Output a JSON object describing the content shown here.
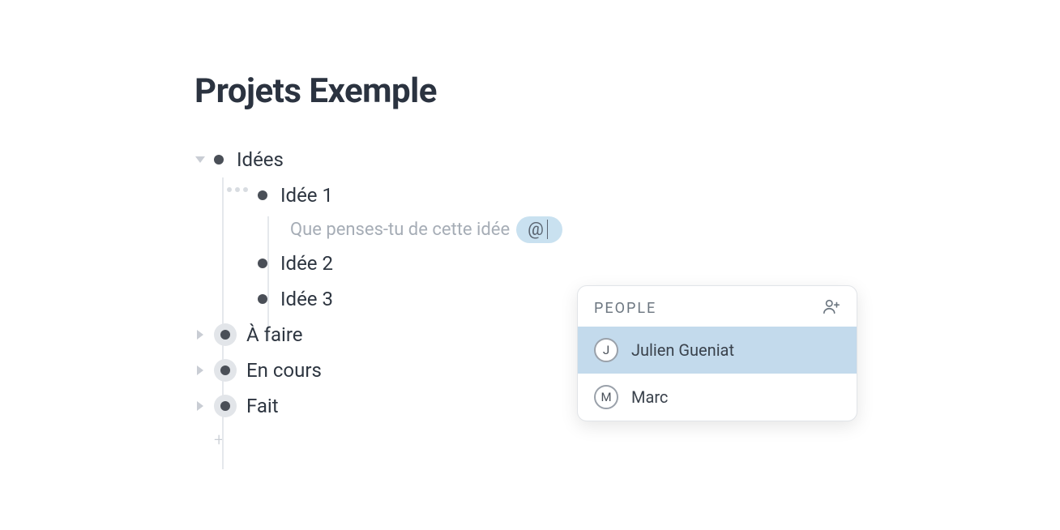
{
  "page": {
    "title": "Projets Exemple"
  },
  "outline": {
    "idees": {
      "label": "Idées",
      "children": {
        "idee1": {
          "label": "Idée 1"
        },
        "idee2": {
          "label": "Idée 2"
        },
        "idee3": {
          "label": "Idée 3"
        }
      }
    },
    "a_faire": {
      "label": "À faire"
    },
    "en_cours": {
      "label": "En cours"
    },
    "fait": {
      "label": "Fait"
    }
  },
  "comment": {
    "text": "Que penses-tu de cette idée",
    "mention_trigger": "@"
  },
  "mention_popup": {
    "header": "PEOPLE",
    "people": [
      {
        "initial": "J",
        "name": "Julien Gueniat",
        "selected": true
      },
      {
        "initial": "M",
        "name": "Marc",
        "selected": false
      }
    ]
  }
}
